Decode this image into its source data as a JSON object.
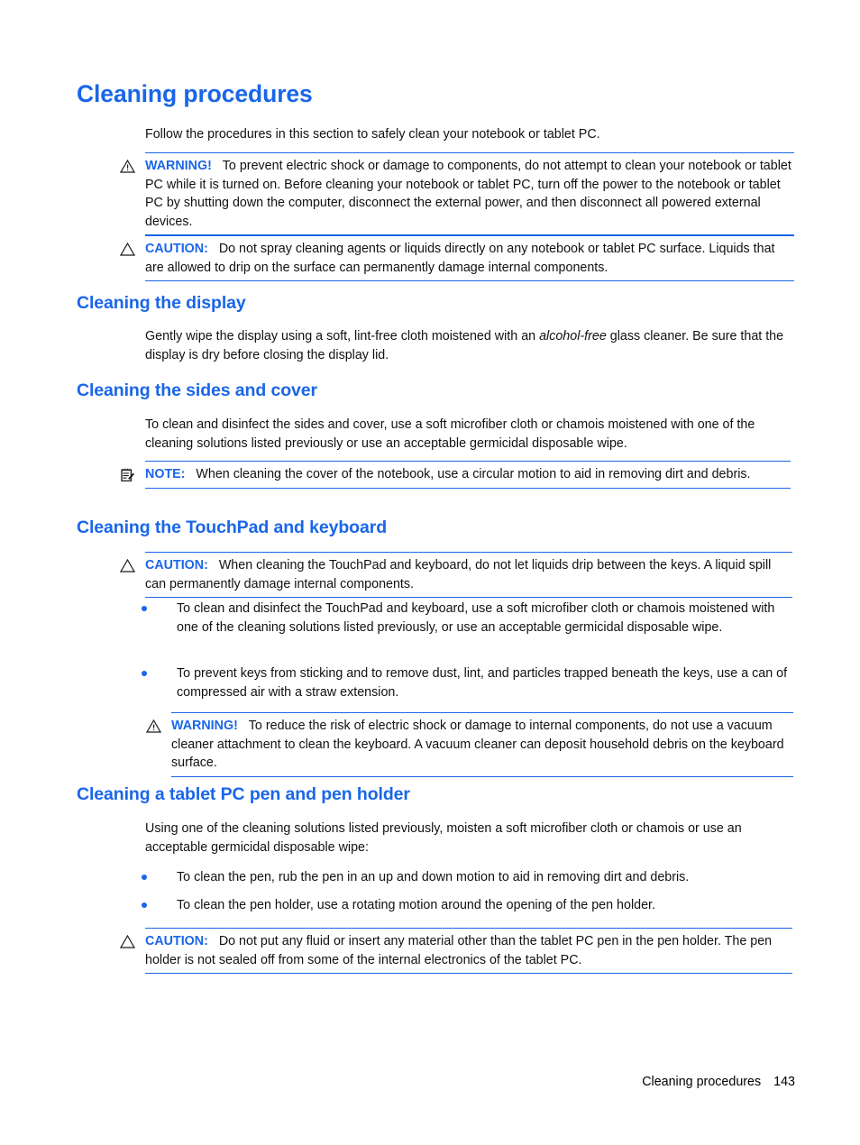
{
  "colors": {
    "accent_blue": "#1a66e8",
    "text_black": "#111111",
    "rule_blue": "#1a66e8"
  },
  "page": {
    "title": "Cleaning procedures",
    "intro": "Follow the procedures in this section to safely clean your notebook or tablet PC.",
    "footer_text": "Cleaning procedures",
    "footer_page_number": "143"
  },
  "labels": {
    "warning": "WARNING!",
    "caution": "CAUTION:",
    "note": "NOTE:"
  },
  "icons": {
    "warning": "warning-triangle-icon",
    "caution": "caution-triangle-icon",
    "note": "note-clipboard-icon",
    "bullet": "bullet-dot-icon"
  },
  "admonitions": {
    "top_warning": {
      "label": "WARNING!",
      "text": "To prevent electric shock or damage to components, do not attempt to clean your notebook or tablet PC while it is turned on. Before cleaning your notebook or tablet PC, turn off the power to the notebook or tablet PC by shutting down the computer, disconnect the external power, and then disconnect all powered external devices."
    },
    "top_caution": {
      "label": "CAUTION:",
      "text": "Do not spray cleaning agents or liquids directly on any notebook or tablet PC surface. Liquids that are allowed to drip on the surface can permanently damage internal components."
    },
    "cover_note": {
      "label": "NOTE:",
      "text": "When cleaning the cover of the notebook, use a circular motion to aid in removing dirt and debris."
    },
    "touchpad_caution": {
      "label": "CAUTION:",
      "text": "When cleaning the TouchPad and keyboard, do not let liquids drip between the keys. A liquid spill can permanently damage internal components."
    },
    "keyboard_warning": {
      "label": "WARNING!",
      "text": "To reduce the risk of electric shock or damage to internal components, do not use a vacuum cleaner attachment to clean the keyboard. A vacuum cleaner can deposit household debris on the keyboard surface."
    },
    "pen_caution": {
      "label": "CAUTION:",
      "text": "Do not put any fluid or insert any material other than the tablet PC pen in the pen holder. The pen holder is not sealed off from some of the internal electronics of the tablet PC."
    }
  },
  "sections": {
    "display": {
      "heading": "Cleaning the display",
      "para_before_italic": "Gently wipe the display using a soft, lint-free cloth moistened with an ",
      "para_italic": "alcohol-free",
      "para_after_italic": " glass cleaner. Be sure that the display is dry before closing the display lid."
    },
    "sides_cover": {
      "heading": "Cleaning the sides and cover",
      "para": "To clean and disinfect the sides and cover, use a soft microfiber cloth or chamois moistened with one of the cleaning solutions listed previously or use an acceptable germicidal disposable wipe."
    },
    "touchpad": {
      "heading": "Cleaning the TouchPad and keyboard",
      "bullets": [
        "To clean and disinfect the TouchPad and keyboard, use a soft microfiber cloth or chamois moistened with one of the cleaning solutions listed previously, or use an acceptable germicidal disposable wipe.",
        "To prevent keys from sticking and to remove dust, lint, and particles trapped beneath the keys, use a can of compressed air with a straw extension."
      ]
    },
    "pen_holder": {
      "heading": "Cleaning a tablet PC pen and pen holder",
      "para": "Using one of the cleaning solutions listed previously, moisten a soft microfiber cloth or chamois or use an acceptable germicidal disposable wipe:",
      "bullets": [
        "To clean the pen, rub the pen in an up and down motion to aid in removing dirt and debris.",
        "To clean the pen holder, use a rotating motion around the opening of the pen holder."
      ]
    }
  }
}
